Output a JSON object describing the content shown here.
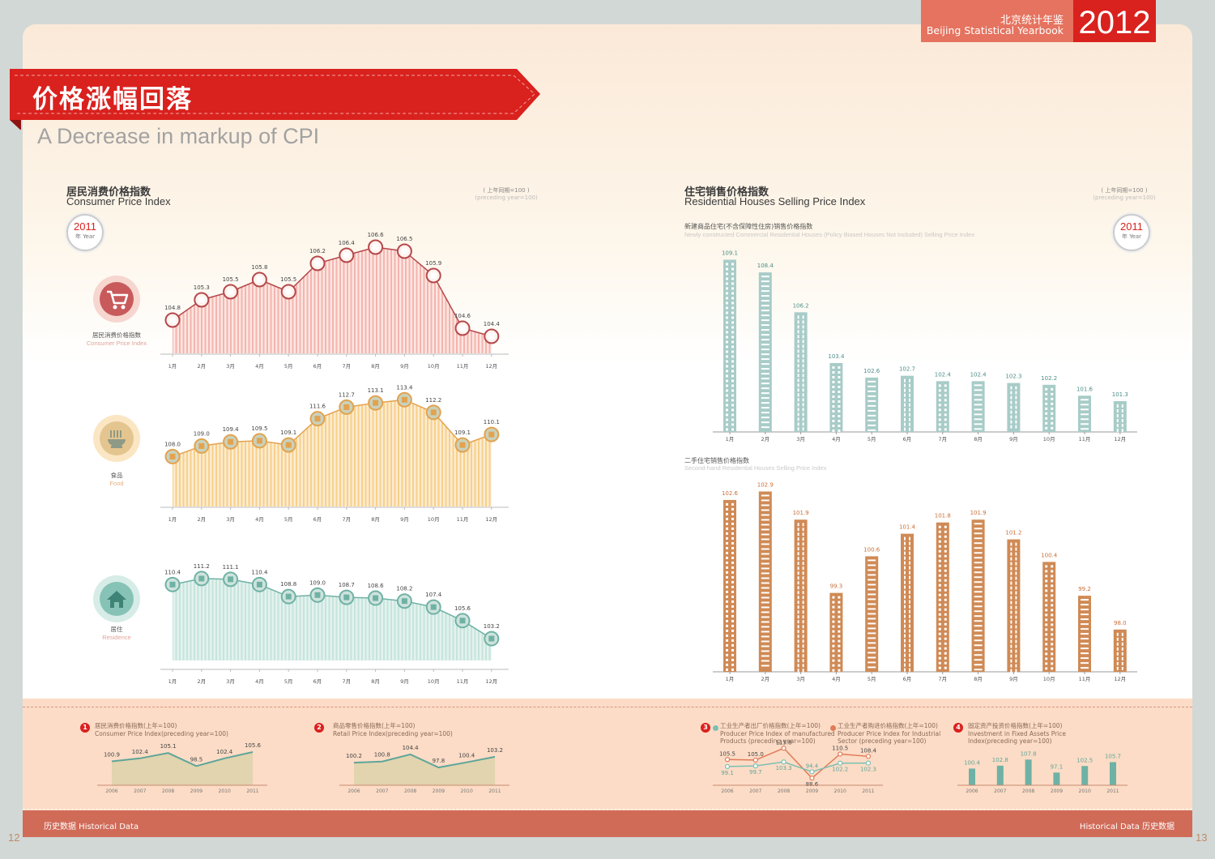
{
  "header": {
    "yearbook_cn": "北京统计年鉴",
    "yearbook_en": "Beijing Statistical Yearbook",
    "year": "2012"
  },
  "title": {
    "cn": "价格涨幅回落",
    "en": "A Decrease in markup of CPI"
  },
  "left": {
    "title_cn": "居民消费价格指数",
    "title_en": "Consumer Price Index",
    "base_cn": "( 上年同期=100 )",
    "base_en": "(preceding year=100)",
    "stamp": {
      "year": "2011",
      "label": "年 Year"
    },
    "icons": [
      {
        "name": "cart-icon",
        "cn": "居民消费价格指数",
        "en": "Consumer Price Index"
      },
      {
        "name": "noodle-bowl-icon",
        "cn": "食品",
        "en": "Food"
      },
      {
        "name": "house-icon",
        "cn": "居住",
        "en": "Residence"
      }
    ]
  },
  "right": {
    "title_cn": "住宅销售价格指数",
    "title_en": "Residential Houses Selling Price Index",
    "base_cn": "( 上年同期=100 )",
    "base_en": "(preceding year=100)",
    "stamp": {
      "year": "2011",
      "label": "年 Year"
    },
    "sub1_cn": "新建商品住宅(不含保障性住房)销售价格指数",
    "sub1_en": "Newly constructed Commercial Residential Houses (Policy Biased Houses Not Included) Selling Price Index",
    "sub2_cn": "二手住宅销售价格指数",
    "sub2_en": "Second-hand Residential Houses Selling Price Index"
  },
  "history": {
    "items": [
      {
        "num": "1",
        "cn": "居民消费价格指数(上年=100)",
        "en": "Consumer Price Index(preceding year=100)"
      },
      {
        "num": "2",
        "cn": "商品零售价格指数(上年=100)",
        "en": "Retail Price Index(preceding year=100)"
      },
      {
        "num": "3",
        "cn": "工业生产者出厂价格指数(上年=100)",
        "en": "Producer Price Index of manufactured",
        "en2": "Products (preceding year=100)",
        "cn_b": "工业生产者购进价格指数(上年=100)",
        "en_b": "Producer Price Index for Industrial",
        "en_b2": "Sector (preceding year=100)"
      },
      {
        "num": "4",
        "cn": "固定资产投资价格指数(上年=100)",
        "en": "Investment in Fixed Assets Price",
        "en2": "Index(preceding year=100)"
      }
    ]
  },
  "footer": {
    "left": "历史数据   Historical Data",
    "right": "Historical Data   历史数据",
    "page_left": "12",
    "page_right": "13"
  },
  "colors": {
    "red": "#d9211e",
    "cpi": "#b5484b",
    "food": "#e3a24f",
    "residence": "#6fb2a5",
    "new_house": "#a8ccc8",
    "second_house": "#d08a55"
  },
  "chart_data": [
    {
      "type": "line",
      "title": "",
      "series": [
        {
          "name": "居民消费价格指数",
          "values": [
            104.8,
            105.3,
            105.5,
            105.8,
            105.5,
            106.2,
            106.4,
            106.6,
            106.5,
            105.9,
            104.6,
            104.4
          ]
        }
      ],
      "categories": [
        "1月",
        "2月",
        "3月",
        "4月",
        "5月",
        "6月",
        "7月",
        "8月",
        "9月",
        "10月",
        "11月",
        "12月"
      ]
    },
    {
      "type": "line",
      "title": "",
      "series": [
        {
          "name": "食品",
          "values": [
            108.0,
            109.0,
            109.4,
            109.5,
            109.1,
            111.6,
            112.7,
            113.1,
            113.4,
            112.2,
            109.1,
            110.1
          ]
        }
      ],
      "categories": [
        "1月",
        "2月",
        "3月",
        "4月",
        "5月",
        "6月",
        "7月",
        "8月",
        "9月",
        "10月",
        "11月",
        "12月"
      ]
    },
    {
      "type": "line",
      "title": "",
      "series": [
        {
          "name": "居住",
          "values": [
            110.4,
            111.2,
            111.1,
            110.4,
            108.8,
            109.0,
            108.7,
            108.6,
            108.2,
            107.4,
            105.6,
            103.2
          ]
        }
      ],
      "categories": [
        "1月",
        "2月",
        "3月",
        "4月",
        "5月",
        "6月",
        "7月",
        "8月",
        "9月",
        "10月",
        "11月",
        "12月"
      ]
    },
    {
      "type": "bar",
      "title": "新建商品住宅(不含保障性住房)销售价格指数",
      "categories": [
        "1月",
        "2月",
        "3月",
        "4月",
        "5月",
        "6月",
        "7月",
        "8月",
        "9月",
        "10月",
        "11月",
        "12月"
      ],
      "values": [
        109.1,
        108.4,
        106.2,
        103.4,
        102.6,
        102.7,
        102.4,
        102.4,
        102.3,
        102.2,
        101.6,
        101.3
      ]
    },
    {
      "type": "bar",
      "title": "二手住宅销售价格指数",
      "categories": [
        "1月",
        "2月",
        "3月",
        "4月",
        "5月",
        "6月",
        "7月",
        "8月",
        "9月",
        "10月",
        "11月",
        "12月"
      ],
      "values": [
        102.6,
        102.9,
        101.9,
        99.3,
        100.6,
        101.4,
        101.8,
        101.9,
        101.2,
        100.4,
        99.2,
        98.0
      ]
    },
    {
      "type": "area",
      "title": "",
      "x": [
        "2006",
        "2007",
        "2008",
        "2009",
        "2010",
        "2011"
      ],
      "values": [
        100.9,
        102.4,
        105.1,
        98.5,
        102.4,
        105.6
      ]
    },
    {
      "type": "area",
      "title": "",
      "x": [
        "2006",
        "2007",
        "2008",
        "2009",
        "2010",
        "2011"
      ],
      "values": [
        100.2,
        100.8,
        104.4,
        97.8,
        100.4,
        103.2
      ]
    },
    {
      "type": "line",
      "title": "",
      "x": [
        "2006",
        "2007",
        "2008",
        "2009",
        "2010",
        "2011"
      ],
      "series": [
        {
          "values": [
            105.5,
            105.0,
            115.8,
            88.6,
            110.5,
            108.4
          ]
        },
        {
          "values": [
            99.1,
            99.7,
            103.3,
            94.4,
            102.2,
            102.3
          ]
        }
      ]
    },
    {
      "type": "bar",
      "title": "",
      "x": [
        "2006",
        "2007",
        "2008",
        "2009",
        "2010",
        "2011"
      ],
      "values": [
        100.4,
        102.8,
        107.8,
        97.1,
        102.5,
        105.7
      ]
    }
  ]
}
